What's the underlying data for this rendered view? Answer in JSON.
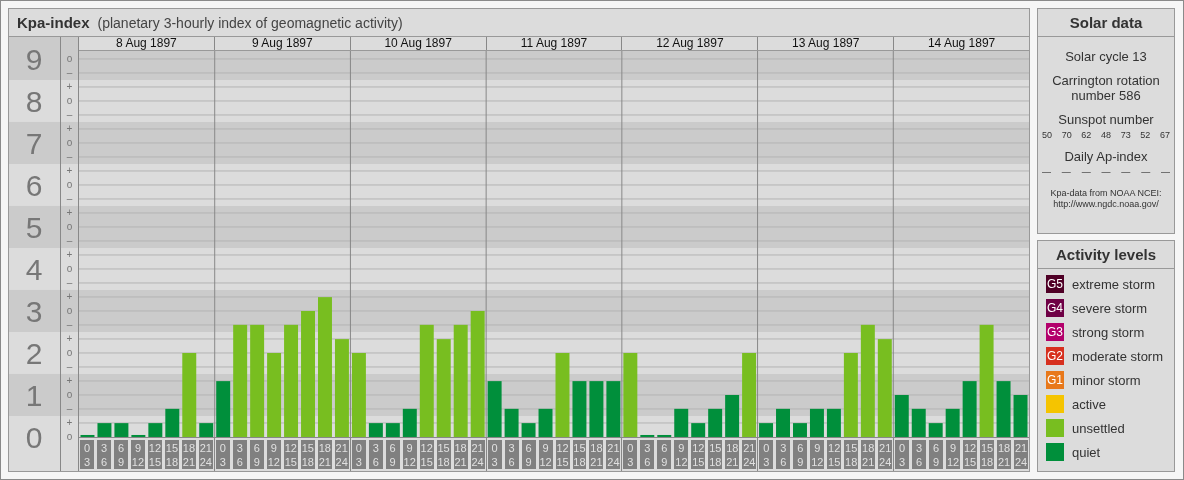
{
  "kpa_panel": {
    "title": "Kpa-index",
    "subtitle": "(planetary 3-hourly index of geomagnetic activity)",
    "days": [
      "8 Aug 1897",
      "9 Aug 1897",
      "10 Aug 1897",
      "11 Aug 1897",
      "12 Aug 1897",
      "13 Aug 1897",
      "14 Aug 1897"
    ],
    "minor_tick_labels": [
      "o",
      "–",
      "+",
      "o",
      "–",
      "+",
      "o",
      "–",
      "+",
      "o",
      "–",
      "+",
      "o",
      "–",
      "+",
      "o",
      "–",
      "+",
      "o",
      "–",
      "+",
      "o",
      "–",
      "+",
      "o",
      "–",
      "+",
      "o"
    ],
    "chart_data": {
      "type": "bar",
      "ylim": [
        0,
        9.19
      ],
      "grid": true,
      "yticks": [
        0,
        1,
        2,
        3,
        4,
        5,
        6,
        7,
        8,
        9
      ],
      "categories": [
        "0 3",
        "3 6",
        "6 9",
        "9 12",
        "12 15",
        "15 18",
        "18 21",
        "21 24",
        "0 3",
        "3 6",
        "6 9",
        "9 12",
        "12 15",
        "15 18",
        "18 21",
        "21 24",
        "0 3",
        "3 6",
        "6 9",
        "9 12",
        "12 15",
        "15 18",
        "18 21",
        "21 24",
        "0 3",
        "3 6",
        "6 9",
        "9 12",
        "12 15",
        "15 18",
        "18 21",
        "21 24",
        "0 3",
        "3 6",
        "6 9",
        "9 12",
        "12 15",
        "15 18",
        "18 21",
        "21 24",
        "0 3",
        "3 6",
        "6 9",
        "9 12",
        "12 15",
        "15 18",
        "18 21",
        "21 24",
        "0 3",
        "3 6",
        "6 9",
        "9 12",
        "12 15",
        "15 18",
        "18 21",
        "21 24"
      ],
      "series": [
        {
          "color": "#008f3b",
          "values": [
            0,
            0.33,
            0.33,
            0,
            0.33,
            0.67,
            null,
            0.33,
            1.33,
            null,
            null,
            null,
            null,
            null,
            null,
            null,
            null,
            0.33,
            0.33,
            0.67,
            null,
            null,
            null,
            null,
            1.33,
            0.67,
            0.33,
            0.67,
            null,
            1.33,
            1.33,
            1.33,
            null,
            0,
            0,
            0.67,
            0.33,
            0.67,
            1,
            null,
            0.33,
            0.67,
            0.33,
            0.67,
            0.67,
            null,
            null,
            null,
            1,
            0.67,
            0.33,
            0.67,
            1.33,
            null,
            1.33,
            1
          ]
        },
        {
          "color": "#78be20",
          "values": [
            null,
            null,
            null,
            null,
            null,
            null,
            2,
            null,
            null,
            2.67,
            2.67,
            2,
            2.67,
            3,
            3.33,
            2.33,
            2,
            null,
            null,
            null,
            2.67,
            2.33,
            2.67,
            3,
            null,
            null,
            null,
            null,
            2,
            null,
            null,
            null,
            2,
            null,
            null,
            null,
            null,
            null,
            null,
            2,
            null,
            null,
            null,
            null,
            null,
            2,
            2.67,
            2.33,
            null,
            null,
            null,
            null,
            null,
            2.67,
            null,
            null
          ]
        }
      ]
    }
  },
  "solar_data": {
    "title": "Solar data",
    "solar_cycle": "Solar cycle 13",
    "carrington": "Carrington rotation number 586",
    "sunspot_label": "Sunspot number",
    "sunspot_numbers": [
      "50",
      "70",
      "62",
      "48",
      "73",
      "52",
      "67"
    ],
    "ap_label": "Daily Ap-index",
    "ap_values": [
      "—",
      "—",
      "—",
      "—",
      "—",
      "—",
      "—"
    ],
    "source": "Kpa-data from NOAA NCEI: http://www.ngdc.noaa.gov/"
  },
  "activity_levels": {
    "title": "Activity levels",
    "items": [
      {
        "badge": "G5",
        "label": "extreme storm",
        "color": "#4f0026"
      },
      {
        "badge": "G4",
        "label": "severe storm",
        "color": "#6e0045"
      },
      {
        "badge": "G3",
        "label": "strong storm",
        "color": "#b3006b"
      },
      {
        "badge": "G2",
        "label": "moderate storm",
        "color": "#d7301f"
      },
      {
        "badge": "G1",
        "label": "minor storm",
        "color": "#e8781a"
      },
      {
        "label": "active",
        "color": "#f5c400"
      },
      {
        "label": "unsettled",
        "color": "#78be20"
      },
      {
        "label": "quiet",
        "color": "#008f3b"
      }
    ]
  }
}
